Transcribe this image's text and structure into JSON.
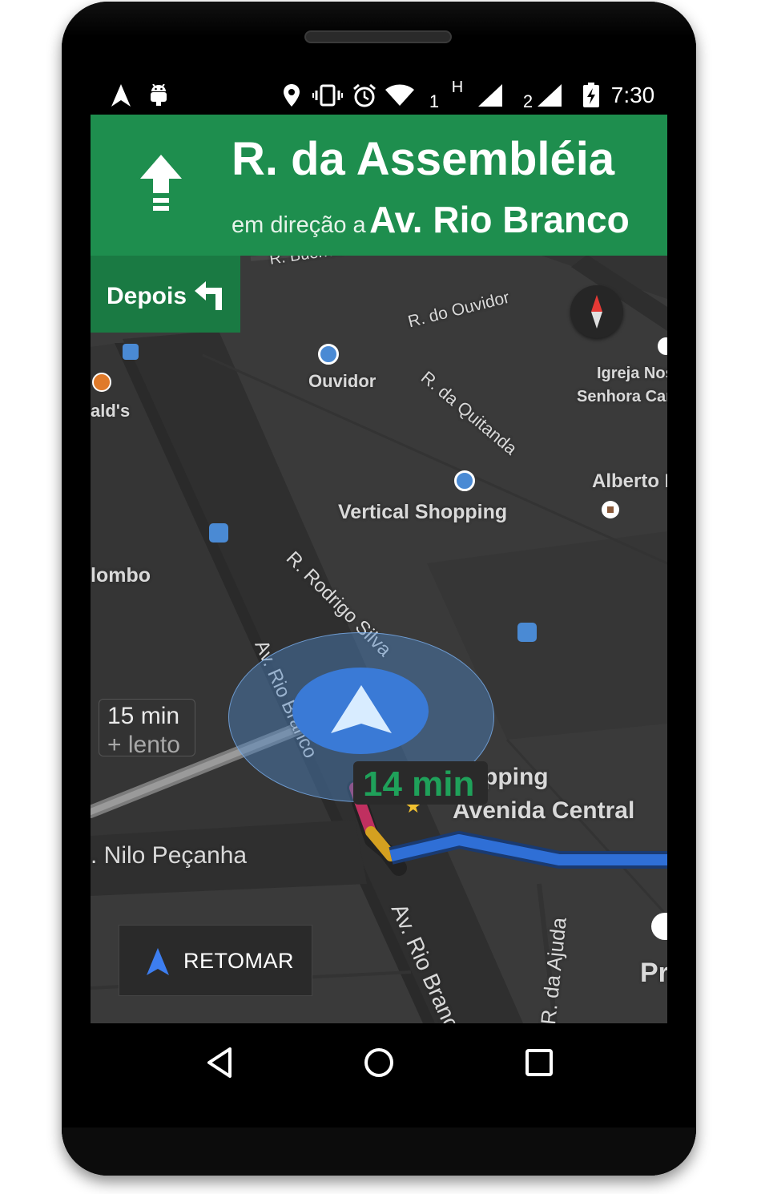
{
  "status_bar": {
    "time": "7:30",
    "sim1": "1",
    "sim1_type": "H",
    "sim2": "2",
    "icons": [
      "navigation-icon",
      "android-icon",
      "location-icon",
      "vibrate-icon",
      "alarm-icon",
      "wifi-icon",
      "signal-icon",
      "signal-icon",
      "battery-charging-icon"
    ]
  },
  "banner": {
    "street": "R. da Assembléia",
    "toward_label": "em direção a",
    "destination": "Av. Rio Branco",
    "icon": "straight-arrow-icon",
    "color": "#1e8e4e"
  },
  "then": {
    "label": "Depois",
    "icon": "turn-left-icon"
  },
  "map": {
    "labels": {
      "buenos_aires": "R. Buenos Ai",
      "ouvidor_street": "R. do Ouvidor",
      "ouvidor_poi": "Ouvidor",
      "igreja_1": "Igreja Nos",
      "igreja_2": "Senhora Car",
      "mcdonalds": "ald's",
      "quitanda": "R. da Quitanda",
      "alberto": "Alberto M",
      "vertical_shopping": "Vertical Shopping",
      "colombo": "lombo",
      "rodrigo_silva": "R. Rodrigo Silva",
      "rio_branco_top": "Av. Rio Branco",
      "shopping_1": "pping",
      "shopping_2": "Avenida Central",
      "nilo": ". Nilo Peçanha",
      "rio_branco_bottom": "Av. Rio Branc",
      "da_ajuda": "R. da Ajuda",
      "pr": "Pr"
    },
    "route_color": "#2f6fd6"
  },
  "alt_route": {
    "time": "15 min",
    "detail": "+ lento"
  },
  "route_eta": {
    "time": "14 min",
    "color": "#1fa15a"
  },
  "resume_button": {
    "label": "RETOMAR",
    "icon": "navigation-arrow-icon"
  },
  "nav_bar": {
    "buttons": [
      "back-icon",
      "home-icon",
      "recents-icon"
    ]
  }
}
